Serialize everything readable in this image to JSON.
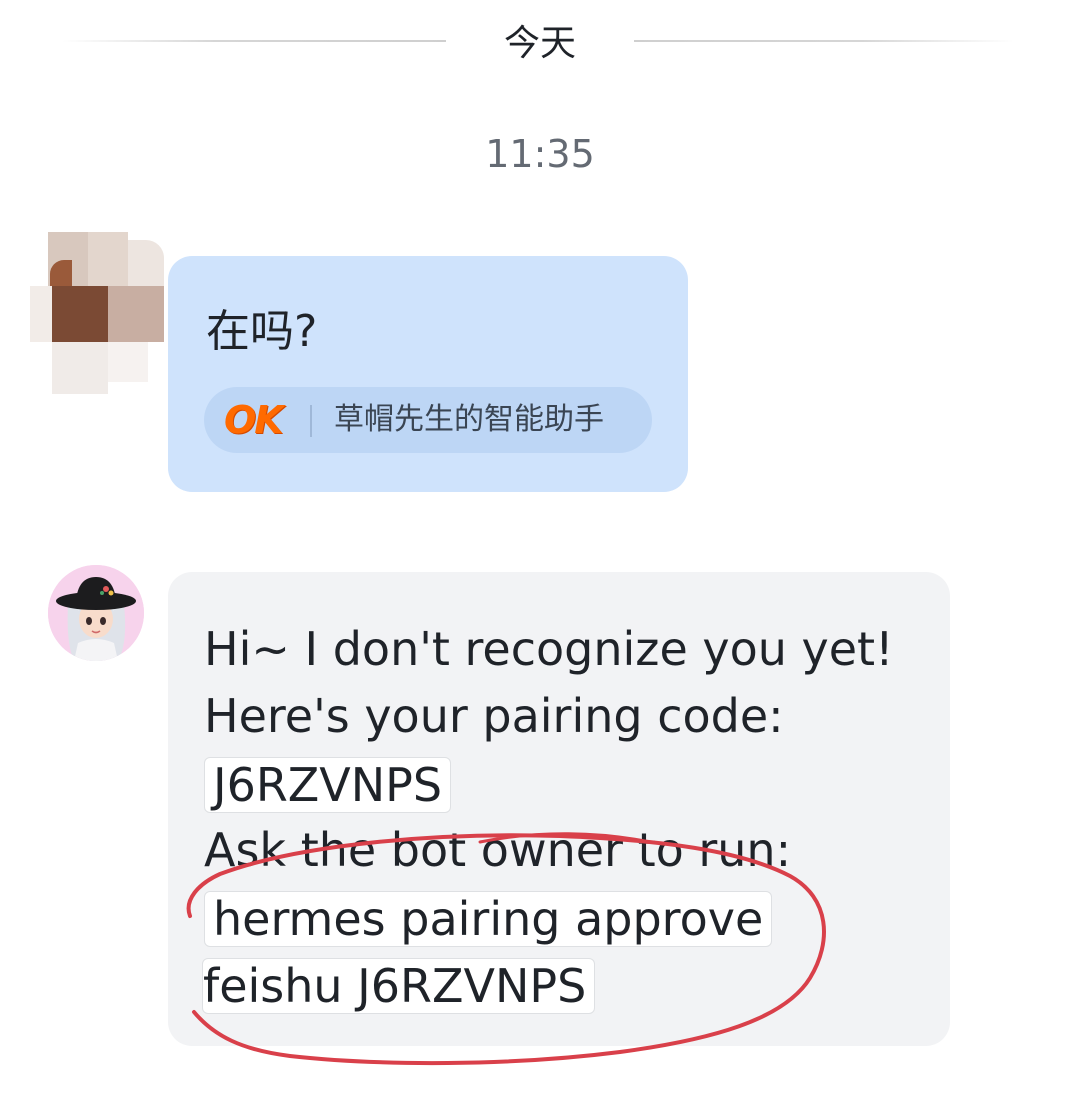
{
  "chat": {
    "date_divider": "今天",
    "timestamp": "11:35"
  },
  "incoming_message": {
    "text": "在吗?",
    "source": {
      "logo_text": "OK",
      "label": "草帽先生的智能助手"
    }
  },
  "bot_reply": {
    "line1": "Hi~ I don't recognize you yet!",
    "line2": "Here's your pairing code:",
    "pairing_code": "J6RZVNPS",
    "line4": "Ask the bot owner to run:",
    "command_line1": "hermes pairing approve",
    "command_line2": "feishu J6RZVNPS"
  },
  "colors": {
    "incoming_bubble": "#cfe3fc",
    "reply_bubble": "#f2f3f5",
    "annotation_circle": "#d9404a",
    "ok_logo": "#ff6a00"
  }
}
